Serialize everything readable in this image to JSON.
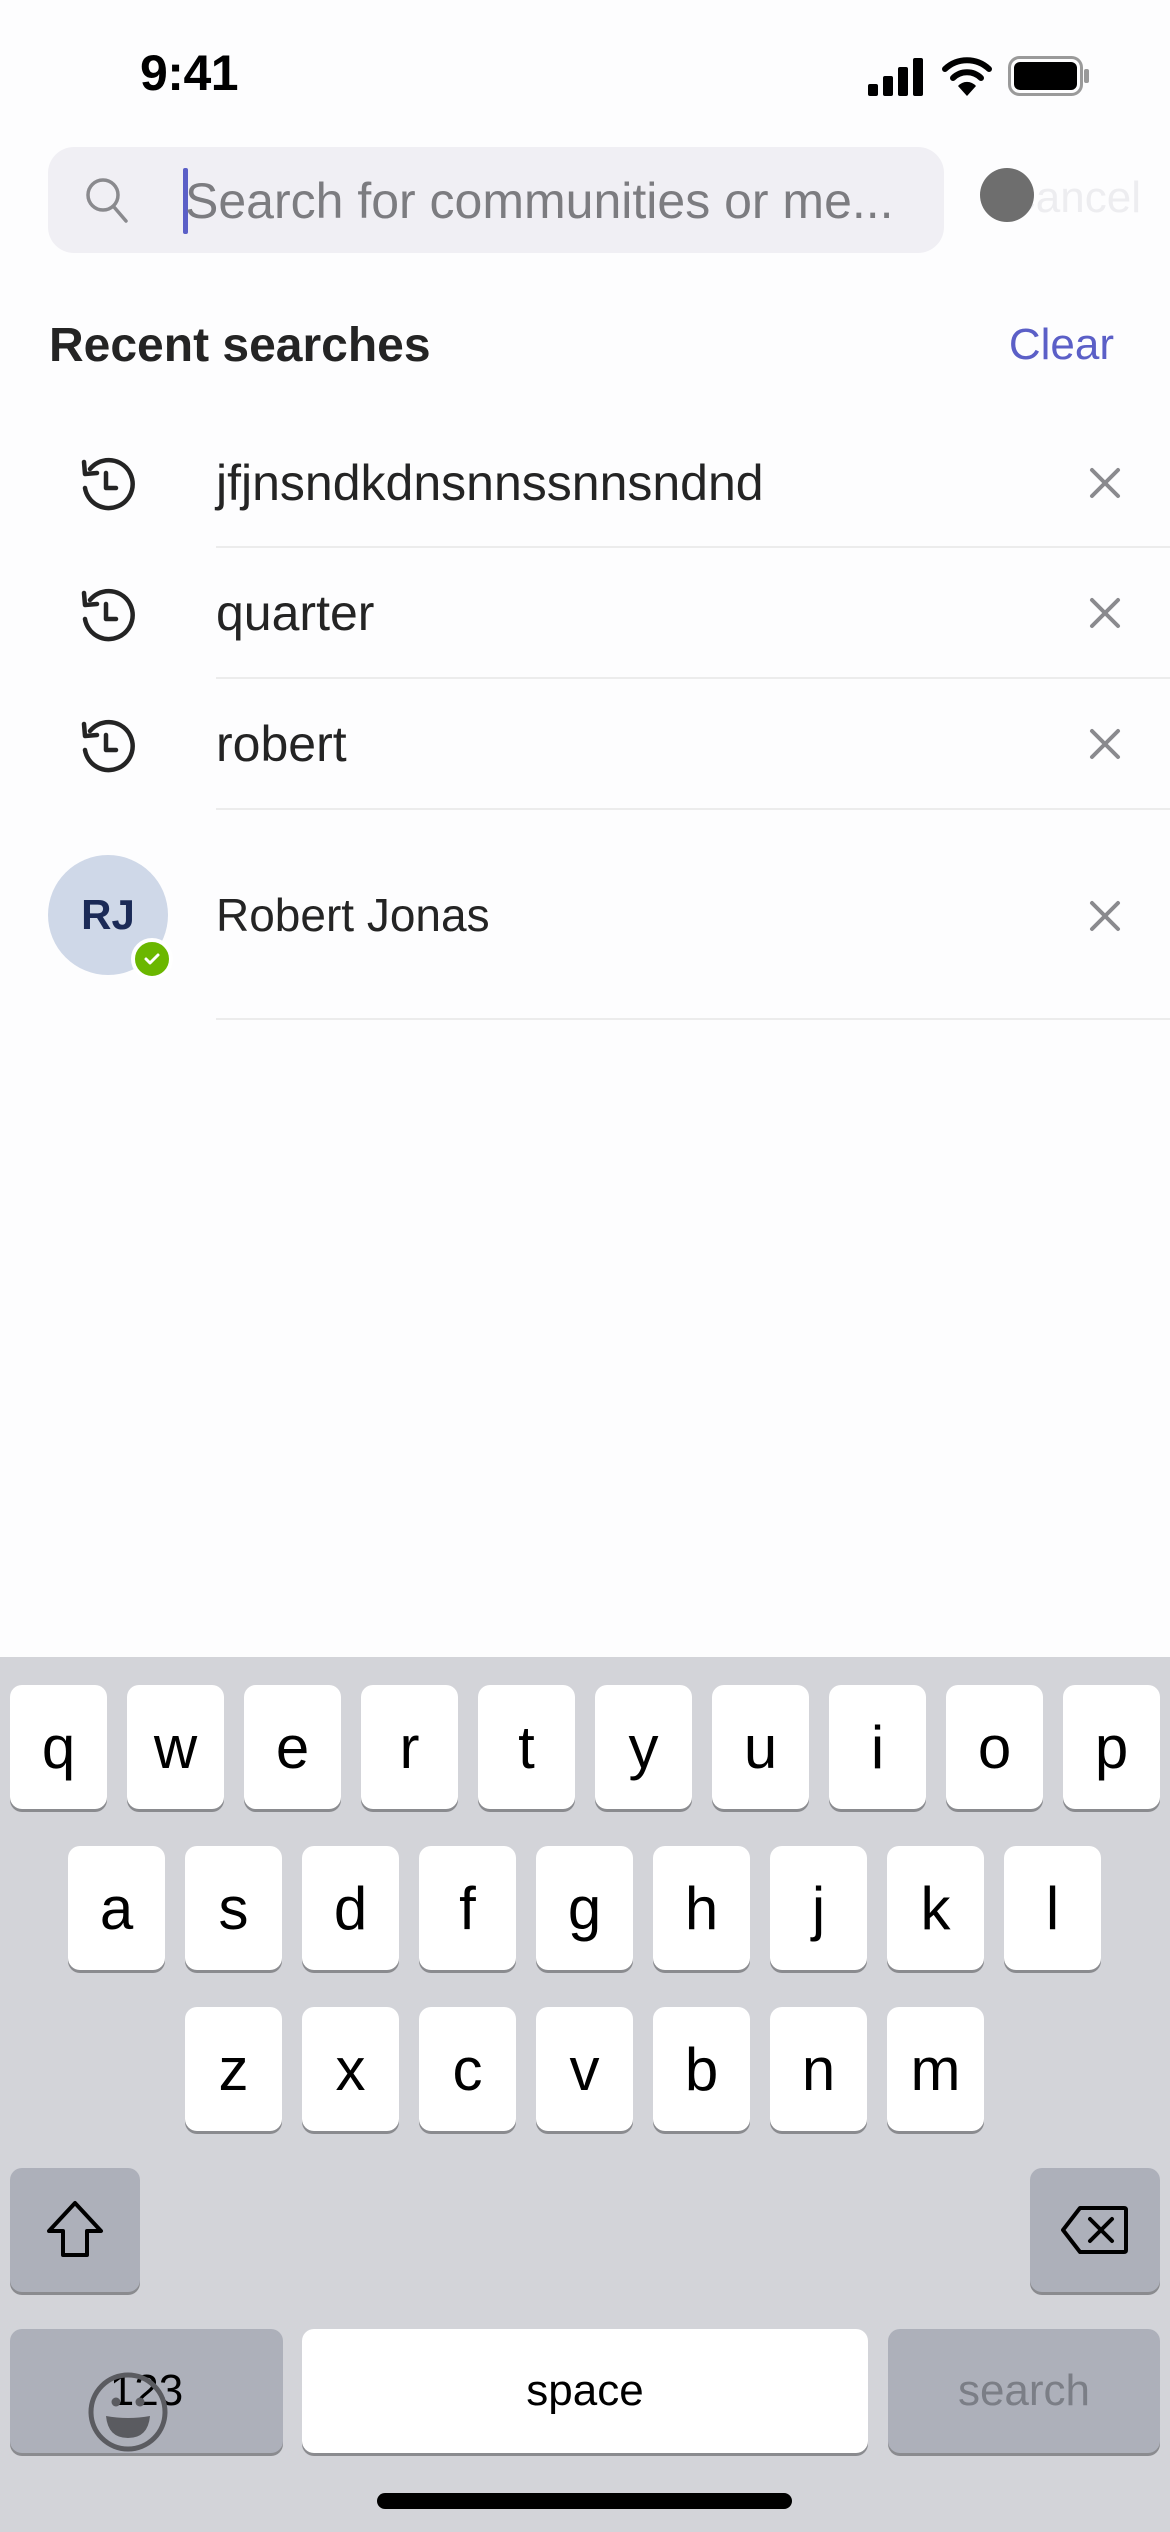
{
  "status_bar": {
    "time": "9:41",
    "icons": [
      "cellular-signal-icon",
      "wifi-icon",
      "battery-icon"
    ]
  },
  "search": {
    "placeholder": "Search for communities or me...",
    "value": "",
    "cancel_label": "Cancel",
    "icon": "search-icon"
  },
  "recent": {
    "title": "Recent searches",
    "clear_label": "Clear",
    "accent_color": "#5b5fc7",
    "items": [
      {
        "text": "jfjnsndkdnsnnssnnsndnd",
        "icon": "history-icon"
      },
      {
        "text": "quarter",
        "icon": "history-icon"
      },
      {
        "text": "robert",
        "icon": "history-icon"
      }
    ],
    "people": [
      {
        "name": "Robert Jonas",
        "initials": "RJ",
        "status": "available",
        "status_color": "#6bb700"
      }
    ]
  },
  "keyboard": {
    "row1": [
      "q",
      "w",
      "e",
      "r",
      "t",
      "y",
      "u",
      "i",
      "o",
      "p"
    ],
    "row2": [
      "a",
      "s",
      "d",
      "f",
      "g",
      "h",
      "j",
      "k",
      "l"
    ],
    "row3": [
      "z",
      "x",
      "c",
      "v",
      "b",
      "n",
      "m"
    ],
    "numbers_label": "123",
    "space_label": "space",
    "action_label": "search"
  }
}
